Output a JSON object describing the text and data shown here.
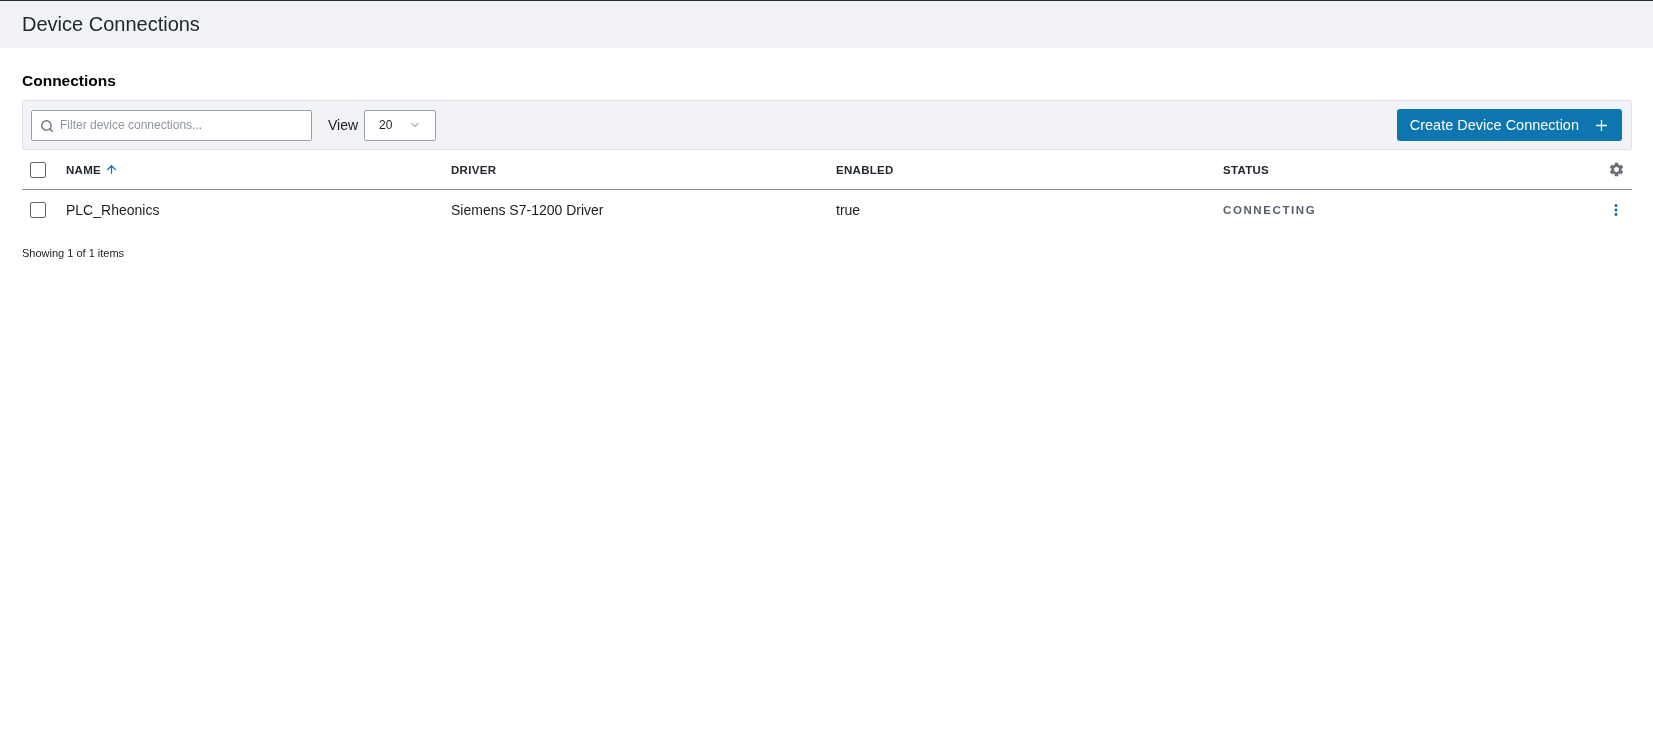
{
  "page_header": {
    "title": "Device Connections"
  },
  "section": {
    "title": "Connections"
  },
  "toolbar": {
    "search": {
      "placeholder": "Filter device connections..."
    },
    "view": {
      "label": "View",
      "value": "20"
    },
    "create_button": {
      "label": "Create Device Connection"
    }
  },
  "table": {
    "select_all": {
      "checked": false
    },
    "columns": [
      {
        "label": "NAME",
        "sorted": true
      },
      {
        "label": "DRIVER",
        "sorted": false
      },
      {
        "label": "ENABLED",
        "sorted": false
      },
      {
        "label": "STATUS",
        "sorted": false
      }
    ],
    "rows": [
      {
        "checked": false,
        "name": "PLC_Rheonics",
        "driver": "Siemens S7-1200 Driver",
        "enabled": "true",
        "status": "CONNECTING"
      }
    ]
  },
  "footer": {
    "summary": "Showing 1 of 1 items"
  }
}
